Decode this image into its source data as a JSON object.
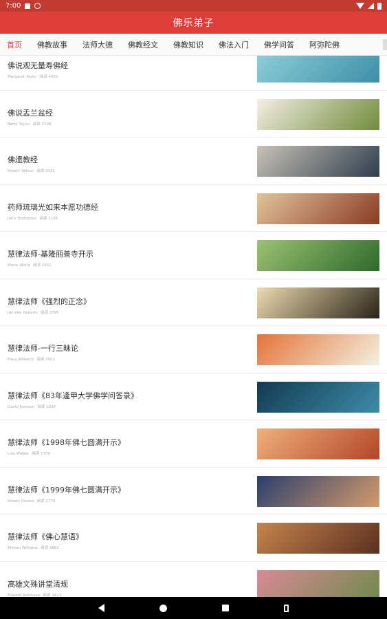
{
  "status": {
    "time": "7:00",
    "icons": [
      "sd-card-icon",
      "do-not-disturb-icon",
      "wifi-icon",
      "signal-icon",
      "battery-icon"
    ]
  },
  "app": {
    "title": "佛乐弟子"
  },
  "tabs": [
    "首页",
    "佛教故事",
    "法师大德",
    "佛教经文",
    "佛教知识",
    "佛法入门",
    "佛学问答",
    "阿弥陀佛"
  ],
  "items": [
    {
      "title": "佛说观无量寿佛经",
      "author": "Margaret Taylor",
      "reads": "阅读 4059"
    },
    {
      "title": "佛说盂兰盆经",
      "author": "Betty Taylor",
      "reads": "阅读 2799"
    },
    {
      "title": "佛遗教经",
      "author": "Robert Wilson",
      "reads": "阅读 2021"
    },
    {
      "title": "药师琉璃光如来本愿功德经",
      "author": "John Thompson",
      "reads": "阅读 1195"
    },
    {
      "title": "慧律法师-基隆丽善寺开示",
      "author": "Maria White",
      "reads": "阅读 2551"
    },
    {
      "title": "慧律法师《强烈的正念》",
      "author": "Jennifer Roberts",
      "reads": "阅读 3795"
    },
    {
      "title": "慧律法师-一行三昧论",
      "author": "Mary Williams",
      "reads": "阅读 3501"
    },
    {
      "title": "慧律法师《83年逢甲大学佛学问答录》",
      "author": "David Johnson",
      "reads": "阅读 1339"
    },
    {
      "title": "慧律法师《1998年佛七圆满开示》",
      "author": "Lisa Walker",
      "reads": "阅读 1700"
    },
    {
      "title": "慧律法师《1999年佛七圆满开示》",
      "author": "Robert Davies",
      "reads": "阅读 2779"
    },
    {
      "title": "慧律法师《佛心慧语》",
      "author": "Steven Williams",
      "reads": "阅读 3862"
    },
    {
      "title": "高雄文殊讲堂清规",
      "author": "Edward Robinson",
      "reads": "阅读 3413"
    }
  ],
  "thumb_colors": [
    [
      "#8fcfd9",
      "#3c8fa8"
    ],
    [
      "#f4eee4",
      "#6f8c3a"
    ],
    [
      "#c9c1b6",
      "#2d3e4e"
    ],
    [
      "#e2c49a",
      "#8a3b22"
    ],
    [
      "#9cc273",
      "#2d6a2a"
    ],
    [
      "#ecdcb0",
      "#2a2218"
    ],
    [
      "#e3743a",
      "#f4f0e0"
    ],
    [
      "#123a52",
      "#3e8ca8"
    ],
    [
      "#f0b07a",
      "#b2452a"
    ],
    [
      "#2a3f6e",
      "#d49a6a"
    ],
    [
      "#c5844c",
      "#5a3020"
    ],
    [
      "#d98a96",
      "#6f8a4c"
    ]
  ]
}
